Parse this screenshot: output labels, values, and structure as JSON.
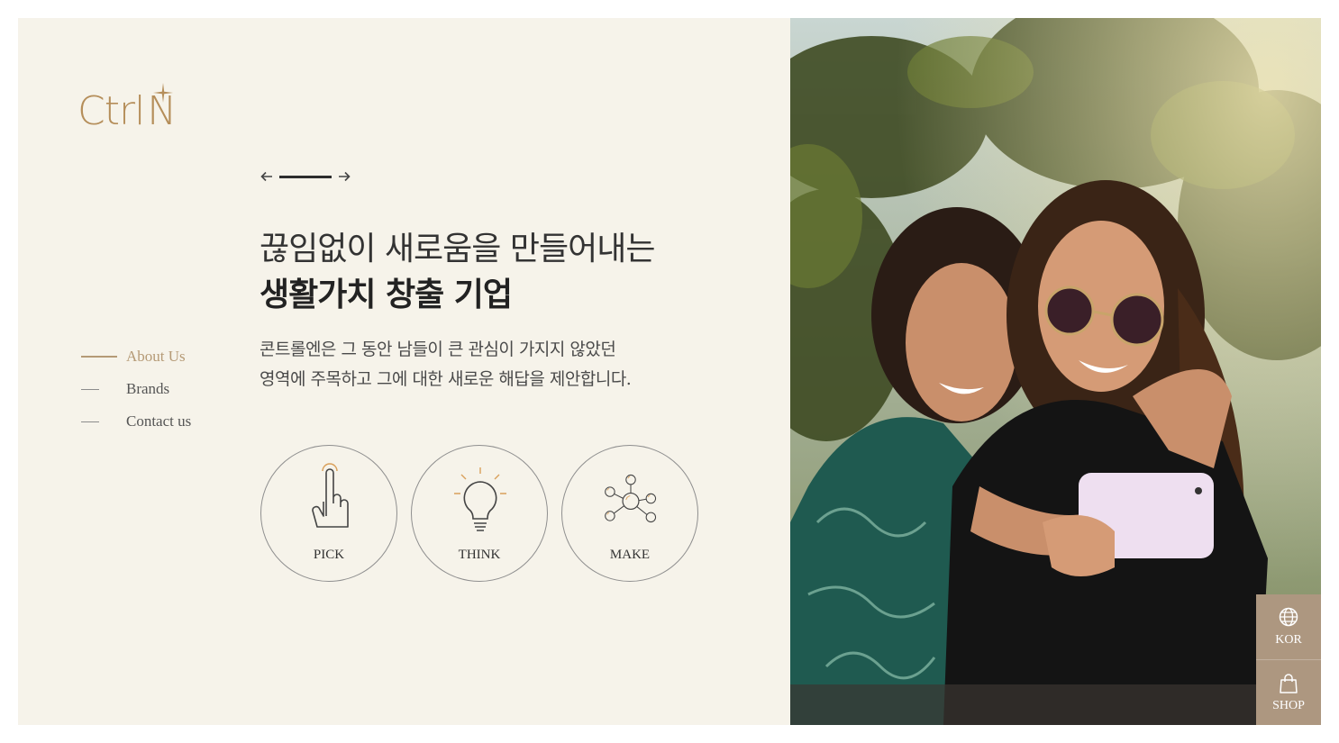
{
  "brand": {
    "logo_text": "Ctrl N",
    "accent_color": "#b58e5a"
  },
  "nav": {
    "items": [
      {
        "label": "About Us",
        "active": true
      },
      {
        "label": "Brands",
        "active": false
      },
      {
        "label": "Contact us",
        "active": false
      }
    ]
  },
  "slider": {
    "prev_icon": "arrow-left-icon",
    "next_icon": "arrow-right-icon"
  },
  "hero": {
    "headline_line1": "끊임없이 새로움을 만들어내는",
    "headline_line2": "생활가치 창출 기업",
    "description_line1": "콘트롤엔은 그 동안 남들이 큰 관심이 가지지 않았던",
    "description_line2": "영역에 주목하고 그에 대한 새로운 해답을 제안합니다."
  },
  "values": [
    {
      "label": "PICK",
      "icon": "pointing-hand-icon"
    },
    {
      "label": "THINK",
      "icon": "lightbulb-icon"
    },
    {
      "label": "MAKE",
      "icon": "network-nodes-icon"
    }
  ],
  "side_buttons": {
    "language_label": "KOR",
    "shop_label": "SHOP",
    "button_color": "#ad9780"
  },
  "colors": {
    "panel_bg": "#f6f3ea",
    "active_nav": "#b59a76"
  }
}
